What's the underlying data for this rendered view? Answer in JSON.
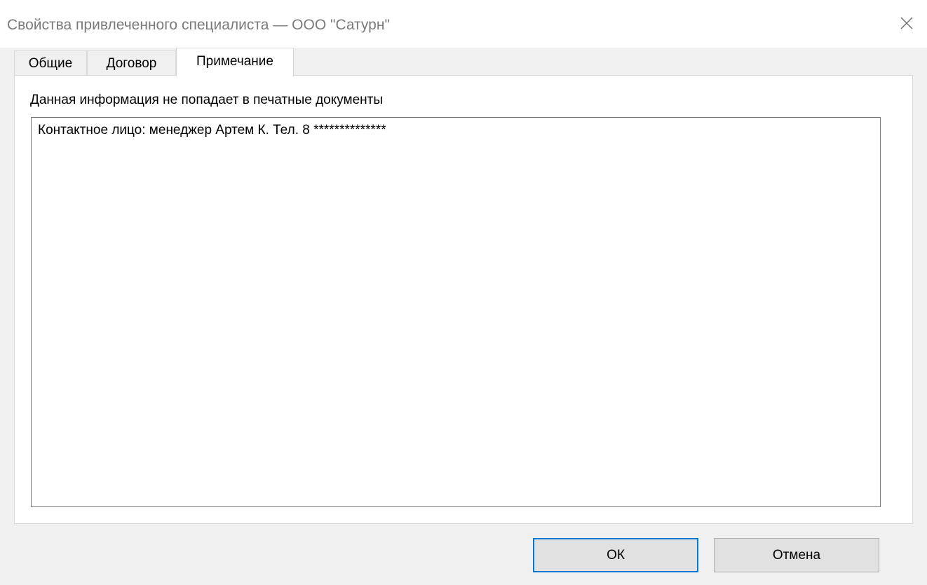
{
  "window": {
    "title": "Свойства привлеченного специалиста — ООО \"Сатурн\"",
    "close_icon": "close-icon"
  },
  "tabs": [
    {
      "label": "Общие",
      "active": false
    },
    {
      "label": "Договор",
      "active": false
    },
    {
      "label": "Примечание",
      "active": true
    }
  ],
  "panel": {
    "info_label": "Данная информация не попадает в печатные документы",
    "note_value": "Контактное лицо: менеджер Артем К. Тел. 8 **************"
  },
  "buttons": {
    "ok_label": "ОК",
    "cancel_label": "Отмена"
  },
  "colors": {
    "accent": "#0078d7",
    "title_text": "#7a7a7a"
  }
}
